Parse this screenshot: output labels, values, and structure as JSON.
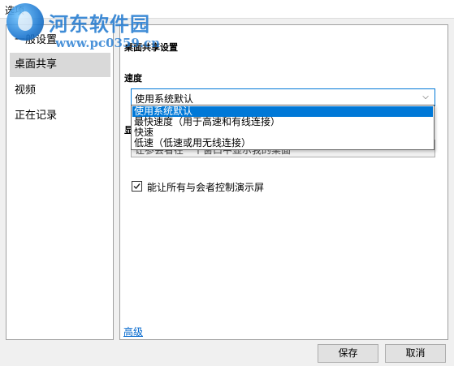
{
  "window": {
    "title": "选项"
  },
  "watermark": {
    "name": "河东软件园",
    "url": "www.pc0359.cn"
  },
  "sidebar": {
    "items": [
      {
        "label": "一般设置",
        "selected": false
      },
      {
        "label": "桌面共享",
        "selected": true
      },
      {
        "label": "视频",
        "selected": false
      },
      {
        "label": "正在记录",
        "selected": false
      }
    ]
  },
  "panel": {
    "section_title": "桌面共享设置",
    "speed_label": "速度",
    "speed_value": "使用系统默认",
    "speed_options": [
      {
        "label": "使用系统默认",
        "selected": true
      },
      {
        "label": "最快速度（用于高速和有线连接）",
        "selected": false
      },
      {
        "label": "快速",
        "selected": false
      },
      {
        "label": "低速（低速或用无线连接）",
        "selected": false
      }
    ],
    "display_label_partial": "显",
    "display_value_partial": "让参会者在一个窗口中显示我的桌面",
    "allow_control": {
      "label": "能让所有与会者控制演示屏",
      "checked": true
    },
    "advanced_link": "高级"
  },
  "footer": {
    "save_label": "保存",
    "cancel_label": "取消"
  },
  "colors": {
    "selection": "#0078d7",
    "link": "#0066cc",
    "watermark": "#1e78d0"
  }
}
